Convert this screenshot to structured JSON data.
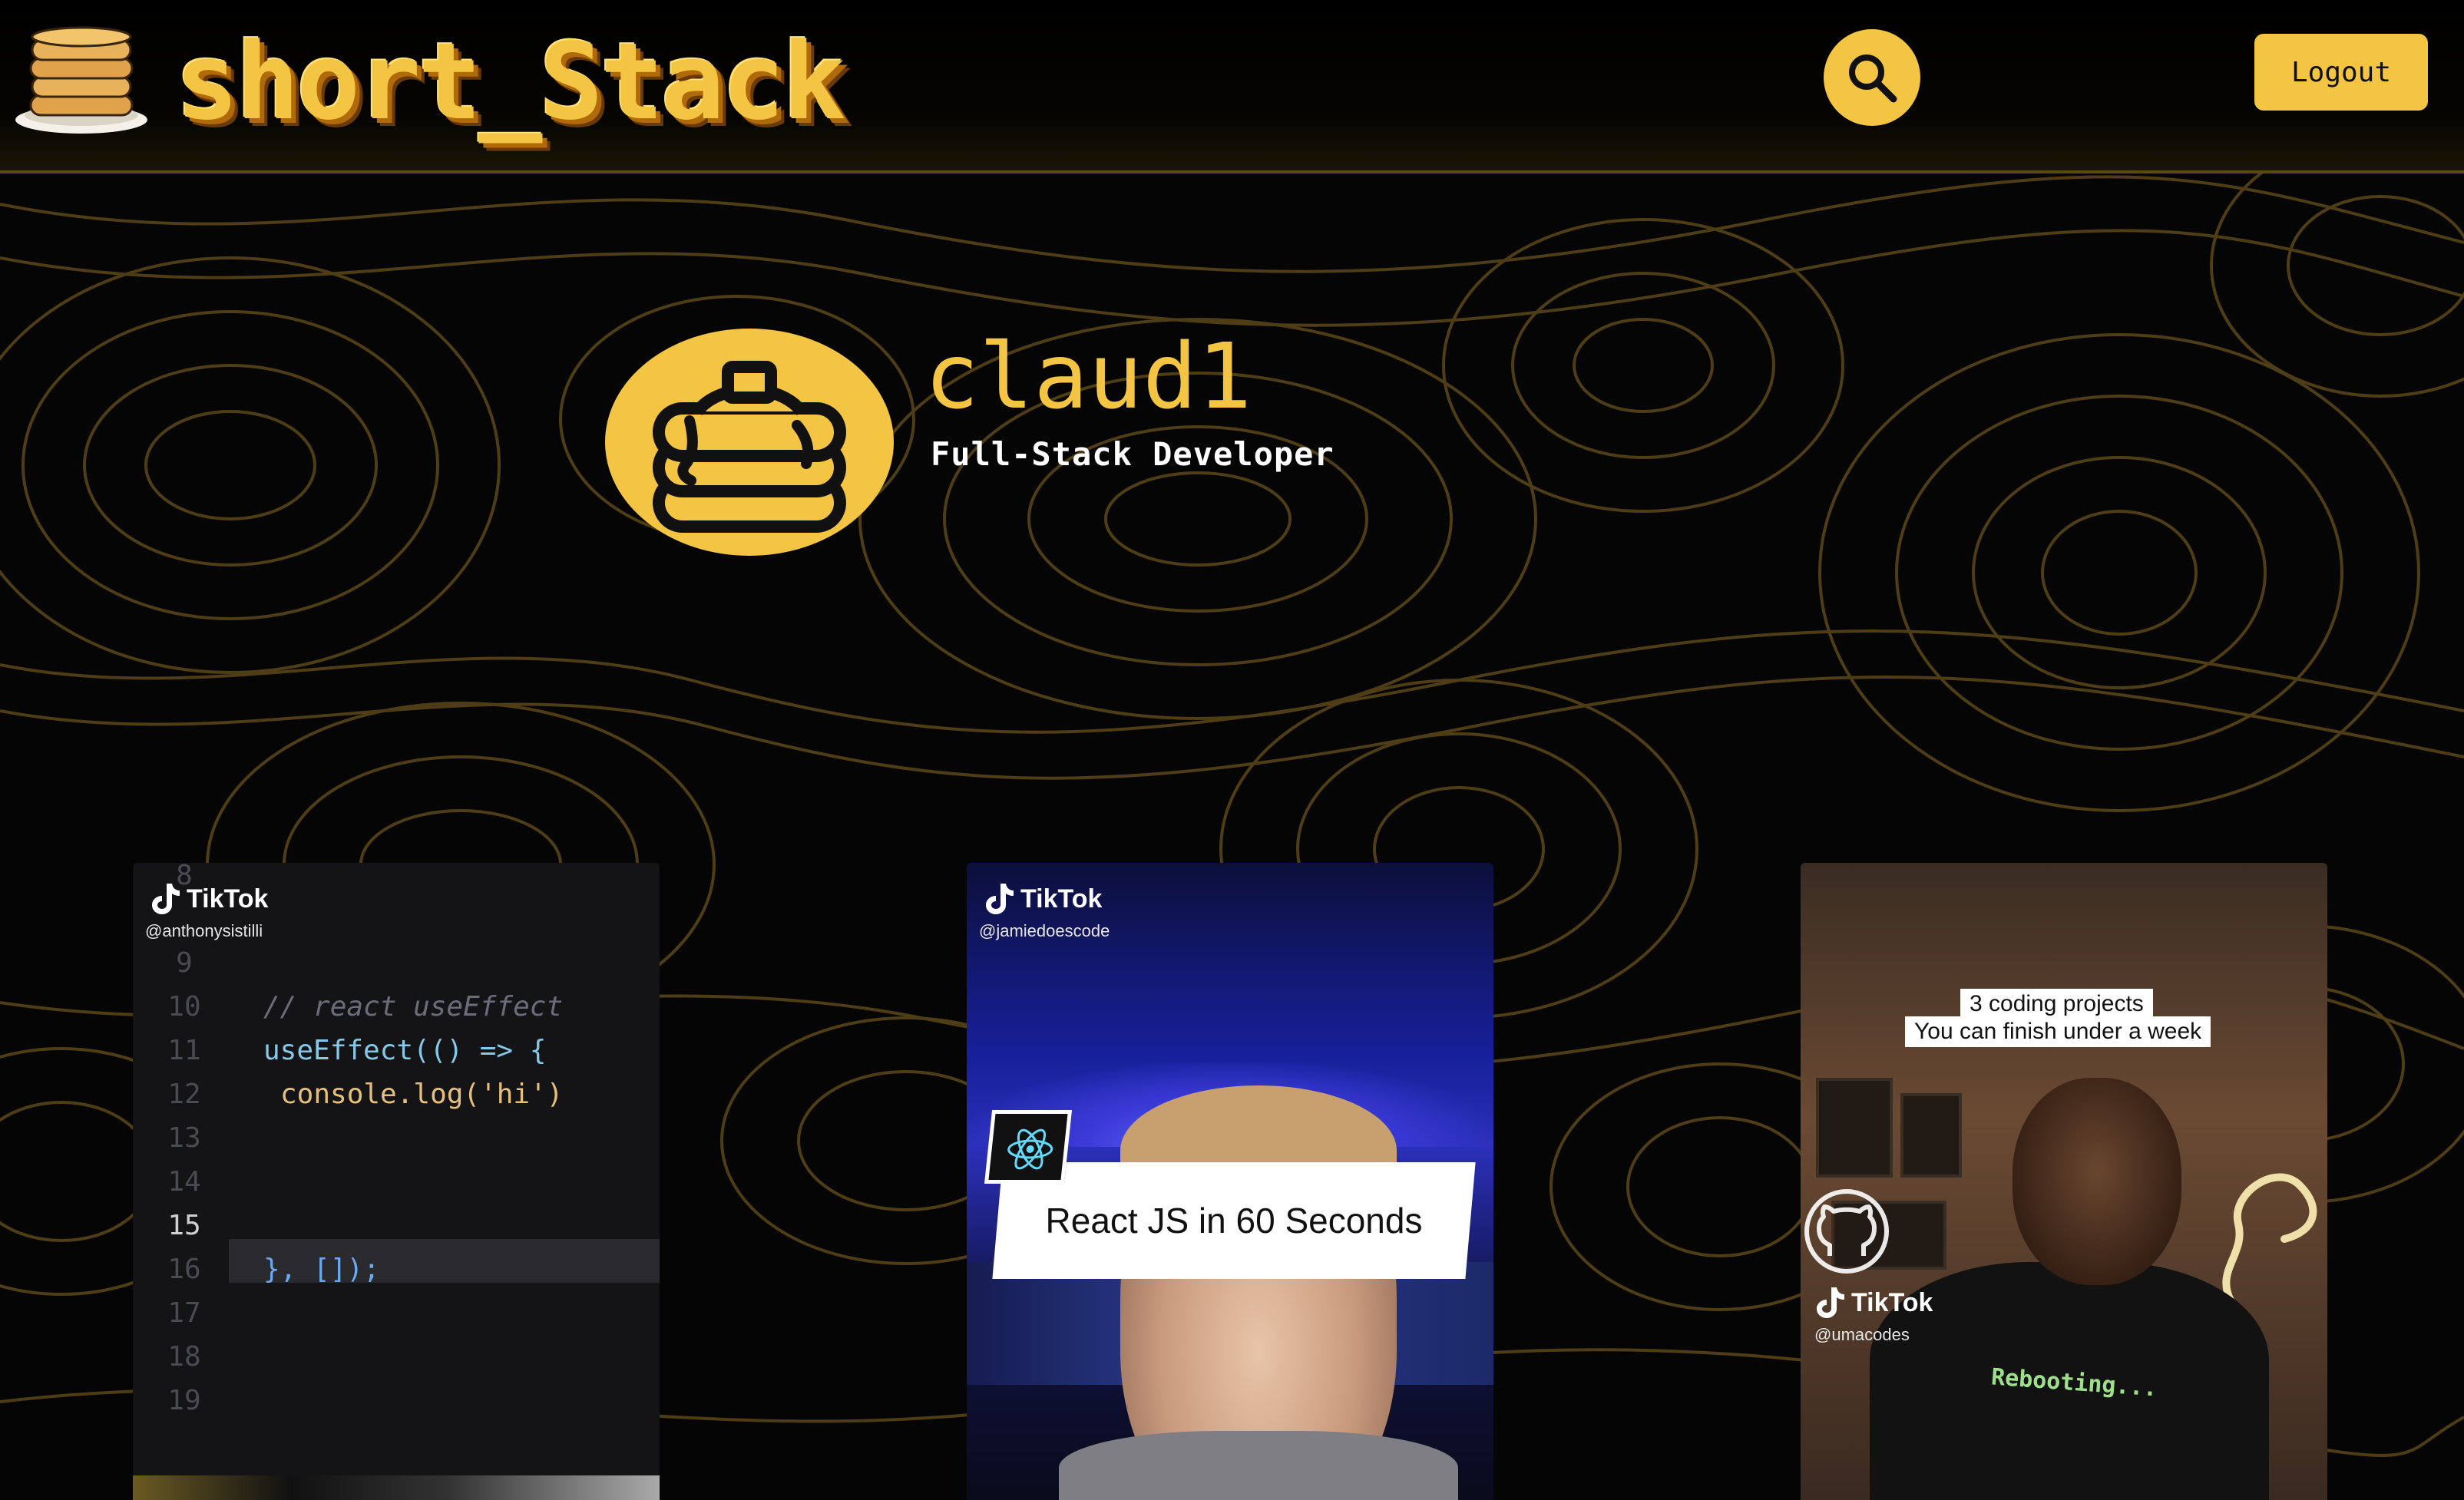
{
  "header": {
    "logo_text": "short_Stack",
    "logout_label": "Logout",
    "accent_color": "#f4c542"
  },
  "profile": {
    "username": "claud1",
    "tagline": "Full-Stack Developer"
  },
  "videos": [
    {
      "platform": "TikTok",
      "handle": "@anthonysistilli",
      "code": {
        "line_numbers": [
          "8",
          "9",
          "10",
          "11",
          "12",
          "13",
          "14",
          "15",
          "16",
          "17",
          "18",
          "19"
        ],
        "comment": "// react useEffect",
        "hook_line": "useEffect(() => {",
        "log_line": "console.log('hi')",
        "close_line": "}, []);",
        "active_line": "15"
      }
    },
    {
      "platform": "TikTok",
      "handle": "@jamiedoescode",
      "banner": "React JS in 60 Seconds"
    },
    {
      "platform": "TikTok",
      "handle": "@umacodes",
      "caption_line1": "3 coding projects",
      "caption_line2": "You can finish under a week",
      "shirt_text": "Rebooting..."
    }
  ]
}
